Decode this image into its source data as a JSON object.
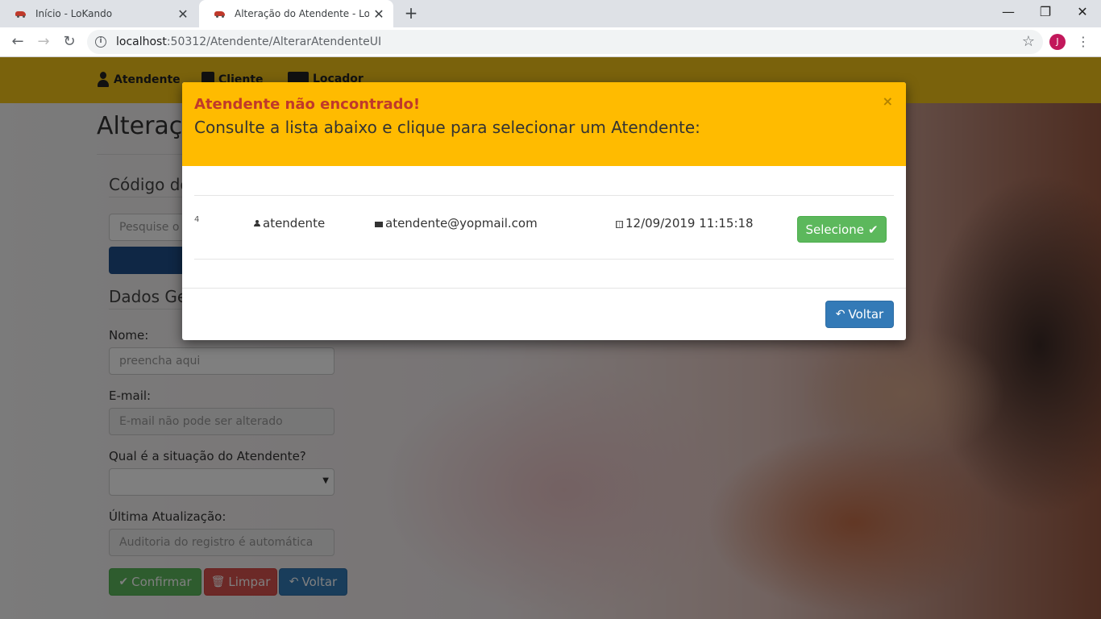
{
  "browser": {
    "tabs": [
      {
        "title": "Início - LoKando",
        "close": "✕"
      },
      {
        "title": "Alteração do Atendente - LoKando",
        "close": "✕"
      }
    ],
    "new_tab": "+",
    "window_controls": {
      "minimize": "—",
      "maximize": "❐",
      "close": "✕"
    },
    "nav": {
      "back": "←",
      "forward": "→",
      "reload": "↻"
    },
    "url_host": "localhost",
    "url_rest": ":50312/Atendente/AlterarAtendenteUI",
    "profile_initial": "J",
    "star": "☆",
    "menu": "⋮"
  },
  "navbar": {
    "items": [
      {
        "label": "Atendente",
        "icon": "user-icon"
      },
      {
        "label": "Cliente",
        "icon": "id-badge-icon"
      },
      {
        "label": "Locador",
        "icon": "id-card-icon"
      }
    ]
  },
  "form": {
    "page_title": "Alteração do Atendente",
    "code_section": "Código do Atendente",
    "search_placeholder": "Pesquise o Atendente",
    "general_section": "Dados Gerais",
    "name_label": "Nome:",
    "name_placeholder": "preencha aqui",
    "email_label": "E-mail:",
    "email_placeholder": "E-mail não pode ser alterado",
    "status_label": "Qual é a situação do Atendente?",
    "status_value": "",
    "updated_label": "Última Atualização:",
    "updated_placeholder": "Auditoria do registro é automática",
    "confirm_label": "Confirmar",
    "clear_label": "Limpar",
    "back_label": "Voltar"
  },
  "modal": {
    "alert_title": "Atendente não encontrado!",
    "subtitle": "Consulte a lista abaixo e clique para selecionar um Atendente:",
    "close": "×",
    "rows": [
      {
        "id": "4",
        "name": "atendente",
        "email": "atendente@yopmail.com",
        "date": "12/09/2019 11:15:18",
        "select_label": "Selecione"
      }
    ],
    "back_label": "Voltar"
  },
  "colors": {
    "navbar": "#f5c518",
    "modal_header": "#ffbb00",
    "alert_text": "#c0392b",
    "success": "#5cb85c",
    "danger": "#d9534f",
    "primary": "#337ab7"
  }
}
